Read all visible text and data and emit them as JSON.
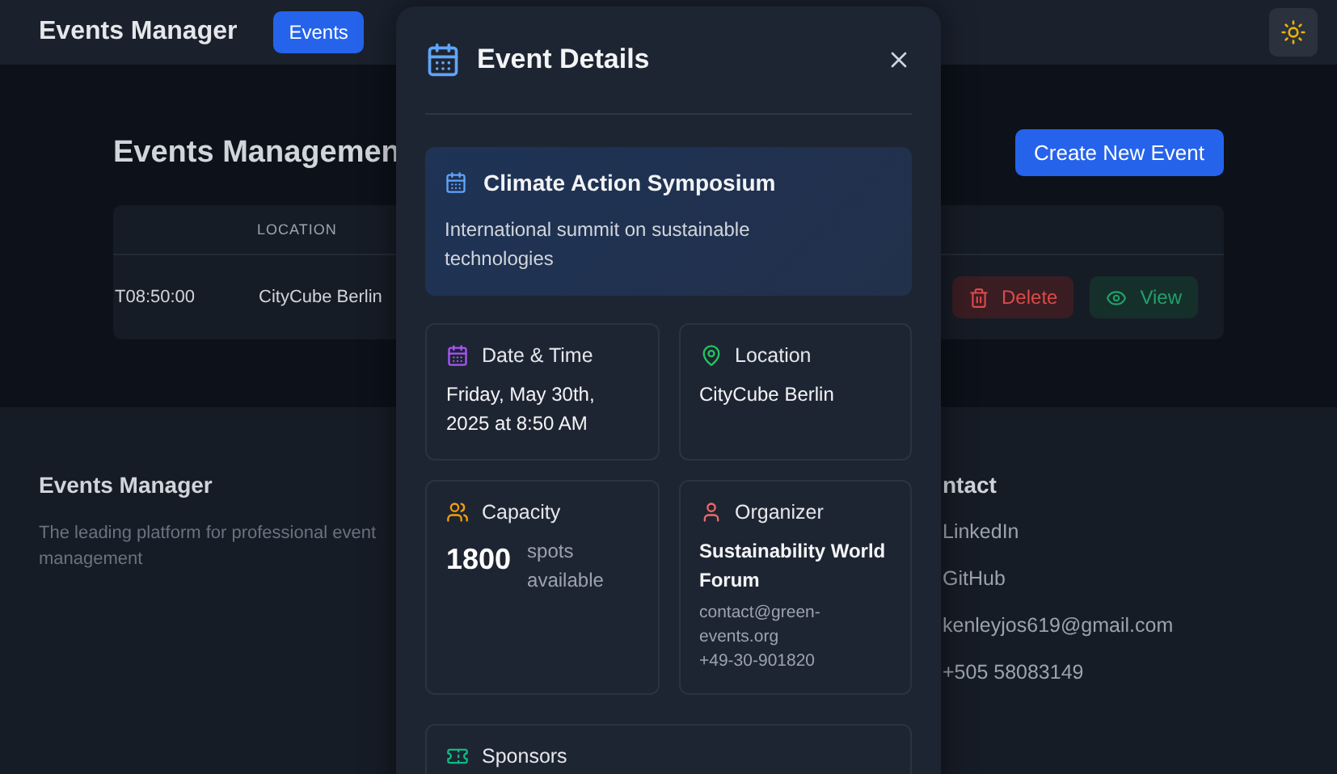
{
  "header": {
    "brand": "Events Manager",
    "nav": [
      {
        "label": "Events",
        "selected": true
      }
    ]
  },
  "page": {
    "title": "Events Managemen",
    "create_button": "Create New Event",
    "table": {
      "columns": [
        "",
        "LOCATION"
      ],
      "rows": [
        {
          "cells": [
            "T08:50:00",
            "CityCube Berlin"
          ],
          "actions": [
            {
              "kind": "delete",
              "label": "Delete"
            },
            {
              "kind": "view",
              "label": "View"
            }
          ]
        }
      ]
    }
  },
  "footer": {
    "brand": "Events Manager",
    "tagline": "The leading platform for professional event management",
    "contact": {
      "heading": "ntact",
      "items": [
        "LinkedIn",
        "GitHub",
        "kenleyjos619@gmail.com",
        "+505 58083149"
      ]
    }
  },
  "modal": {
    "title": "Event Details",
    "event": {
      "name": "Climate Action Symposium",
      "description": "International summit on sustainable technologies"
    },
    "cards": [
      {
        "kind": "datetime",
        "label": "Date & Time",
        "value": "Friday, May 30th, 2025 at 8:50 AM"
      },
      {
        "kind": "location",
        "label": "Location",
        "value": "CityCube Berlin"
      },
      {
        "kind": "capacity",
        "label": "Capacity",
        "number": "1800",
        "unit": "spots available"
      },
      {
        "kind": "organizer",
        "label": "Organizer",
        "name": "Sustainability World Forum",
        "email": "contact@green-events.org",
        "phone": "+49-30-901820"
      }
    ],
    "sponsors": {
      "label": "Sponsors"
    }
  }
}
